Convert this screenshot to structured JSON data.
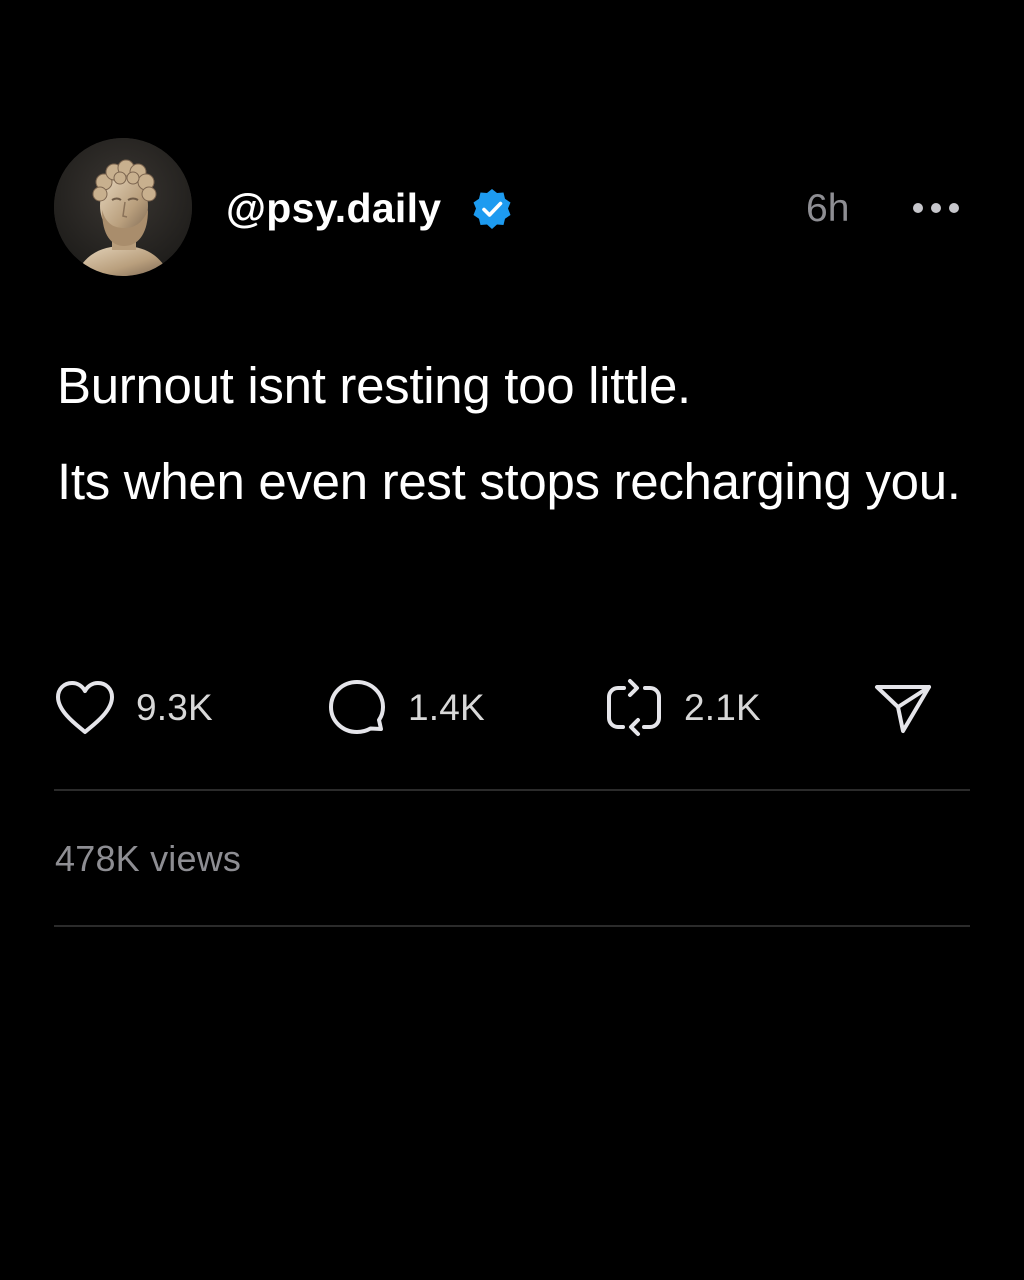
{
  "post": {
    "username": "@psy.daily",
    "verified": true,
    "timestamp": "6h",
    "avatar_icon": "marble-bust-avatar",
    "text": {
      "line1": "Burnout isnt resting too little.",
      "line2": "Its when even rest stops recharging you."
    }
  },
  "actions": {
    "likes": "9.3K",
    "replies": "1.4K",
    "reposts": "2.1K",
    "like_icon": "heart-icon",
    "reply_icon": "comment-bubble-icon",
    "repost_icon": "repost-icon",
    "share_icon": "send-icon"
  },
  "stats": {
    "views": "478K views"
  },
  "colors": {
    "background": "#000000",
    "text": "#ffffff",
    "muted": "#8e8e93",
    "verified_badge": "#1d9bf0",
    "divider": "#2b2b2b"
  }
}
